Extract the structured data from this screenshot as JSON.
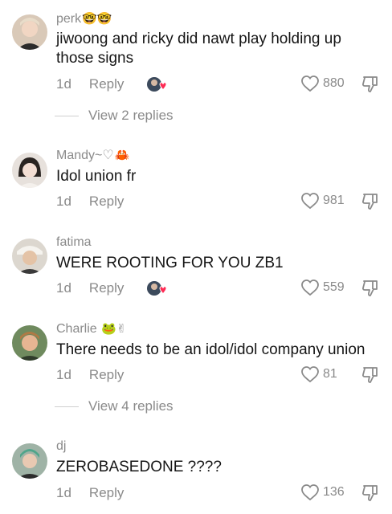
{
  "comments": [
    {
      "author": "perk",
      "author_deco": "🤓🤓",
      "text": "jiwoong and ricky did nawt play holding up those signs",
      "time": "1d",
      "reply_label": "Reply",
      "likes": "880",
      "creator_liked": true,
      "view_replies": "View 2 replies"
    },
    {
      "author": "Mandy~♡",
      "author_deco": "🦀",
      "text": "Idol union fr",
      "time": "1d",
      "reply_label": "Reply",
      "likes": "981",
      "creator_liked": false
    },
    {
      "author": "fatima",
      "author_deco": "",
      "text": "WERE ROOTING FOR YOU ZB1",
      "time": "1d",
      "reply_label": "Reply",
      "likes": "559",
      "creator_liked": true
    },
    {
      "author": "Charlie",
      "author_deco": "🐸✌",
      "text": "There needs to be an idol/idol company union",
      "time": "1d",
      "reply_label": "Reply",
      "likes": "81",
      "creator_liked": false,
      "view_replies": "View 4 replies"
    },
    {
      "author": "dj",
      "author_deco": "",
      "text": "ZEROBASEDONE ????",
      "time": "1d",
      "reply_label": "Reply",
      "likes": "136",
      "creator_liked": false
    }
  ],
  "icons": {
    "like": "heart-outline-icon",
    "dislike": "thumbs-down-icon",
    "creator_like": "creator-liked-badge-icon"
  },
  "colors": {
    "meta_gray": "#8a8a8a",
    "text": "#161616",
    "heart_red": "#fe2c55"
  }
}
